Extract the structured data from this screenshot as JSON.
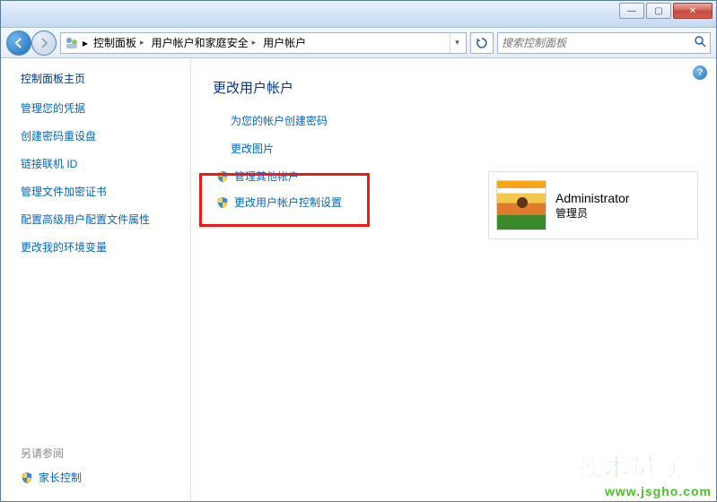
{
  "titlebar": {
    "min_label": "—",
    "max_label": "▢",
    "close_label": "✕"
  },
  "breadcrumbs": {
    "items": [
      "控制面板",
      "用户帐户和家庭安全",
      "用户帐户"
    ]
  },
  "search": {
    "placeholder": "搜索控制面板"
  },
  "sidebar": {
    "title": "控制面板主页",
    "links": [
      "管理您的凭据",
      "创建密码重设盘",
      "链接联机 ID",
      "管理文件加密证书",
      "配置高级用户配置文件属性",
      "更改我的环境变量"
    ],
    "see_also": "另请参阅",
    "parental": "家长控制"
  },
  "main": {
    "heading": "更改用户帐户",
    "tasks": [
      "为您的帐户创建密码",
      "更改图片"
    ],
    "shield_tasks": [
      "管理其他帐户",
      "更改用户帐户控制设置"
    ]
  },
  "account": {
    "name": "Administrator",
    "role": "管理员"
  },
  "watermark": {
    "big": "技术员联盟",
    "small": "www.jsgho.com"
  }
}
